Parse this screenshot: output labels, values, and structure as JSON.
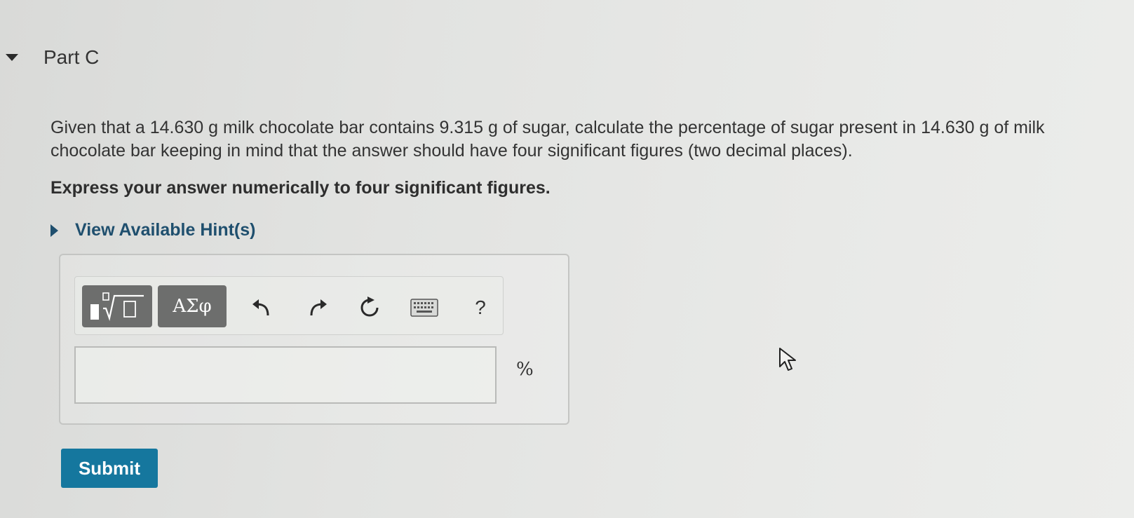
{
  "part": {
    "title": "Part C"
  },
  "question": {
    "text": "Given that a 14.630 g milk chocolate bar contains 9.315 g of sugar, calculate the percentage of sugar present in 14.630 g of milk chocolate bar keeping in mind that the answer should have four significant figures (two decimal places).",
    "instruction": "Express your answer numerically to four significant figures."
  },
  "hint": {
    "label": "View Available Hint(s)"
  },
  "toolbar": {
    "symbols_label": "ΑΣφ",
    "help_label": "?"
  },
  "answer": {
    "value": "",
    "unit": "%"
  },
  "submit": {
    "label": "Submit"
  },
  "colors": {
    "submit_bg": "#15779e",
    "hint_link": "#1f4f6e",
    "toolbar_button": "#6d6e6d"
  },
  "icons": [
    "collapse-caret-icon",
    "expand-caret-icon",
    "templates-icon",
    "undo-icon",
    "redo-icon",
    "reset-icon",
    "keyboard-icon",
    "help-icon",
    "mouse-pointer-icon"
  ]
}
